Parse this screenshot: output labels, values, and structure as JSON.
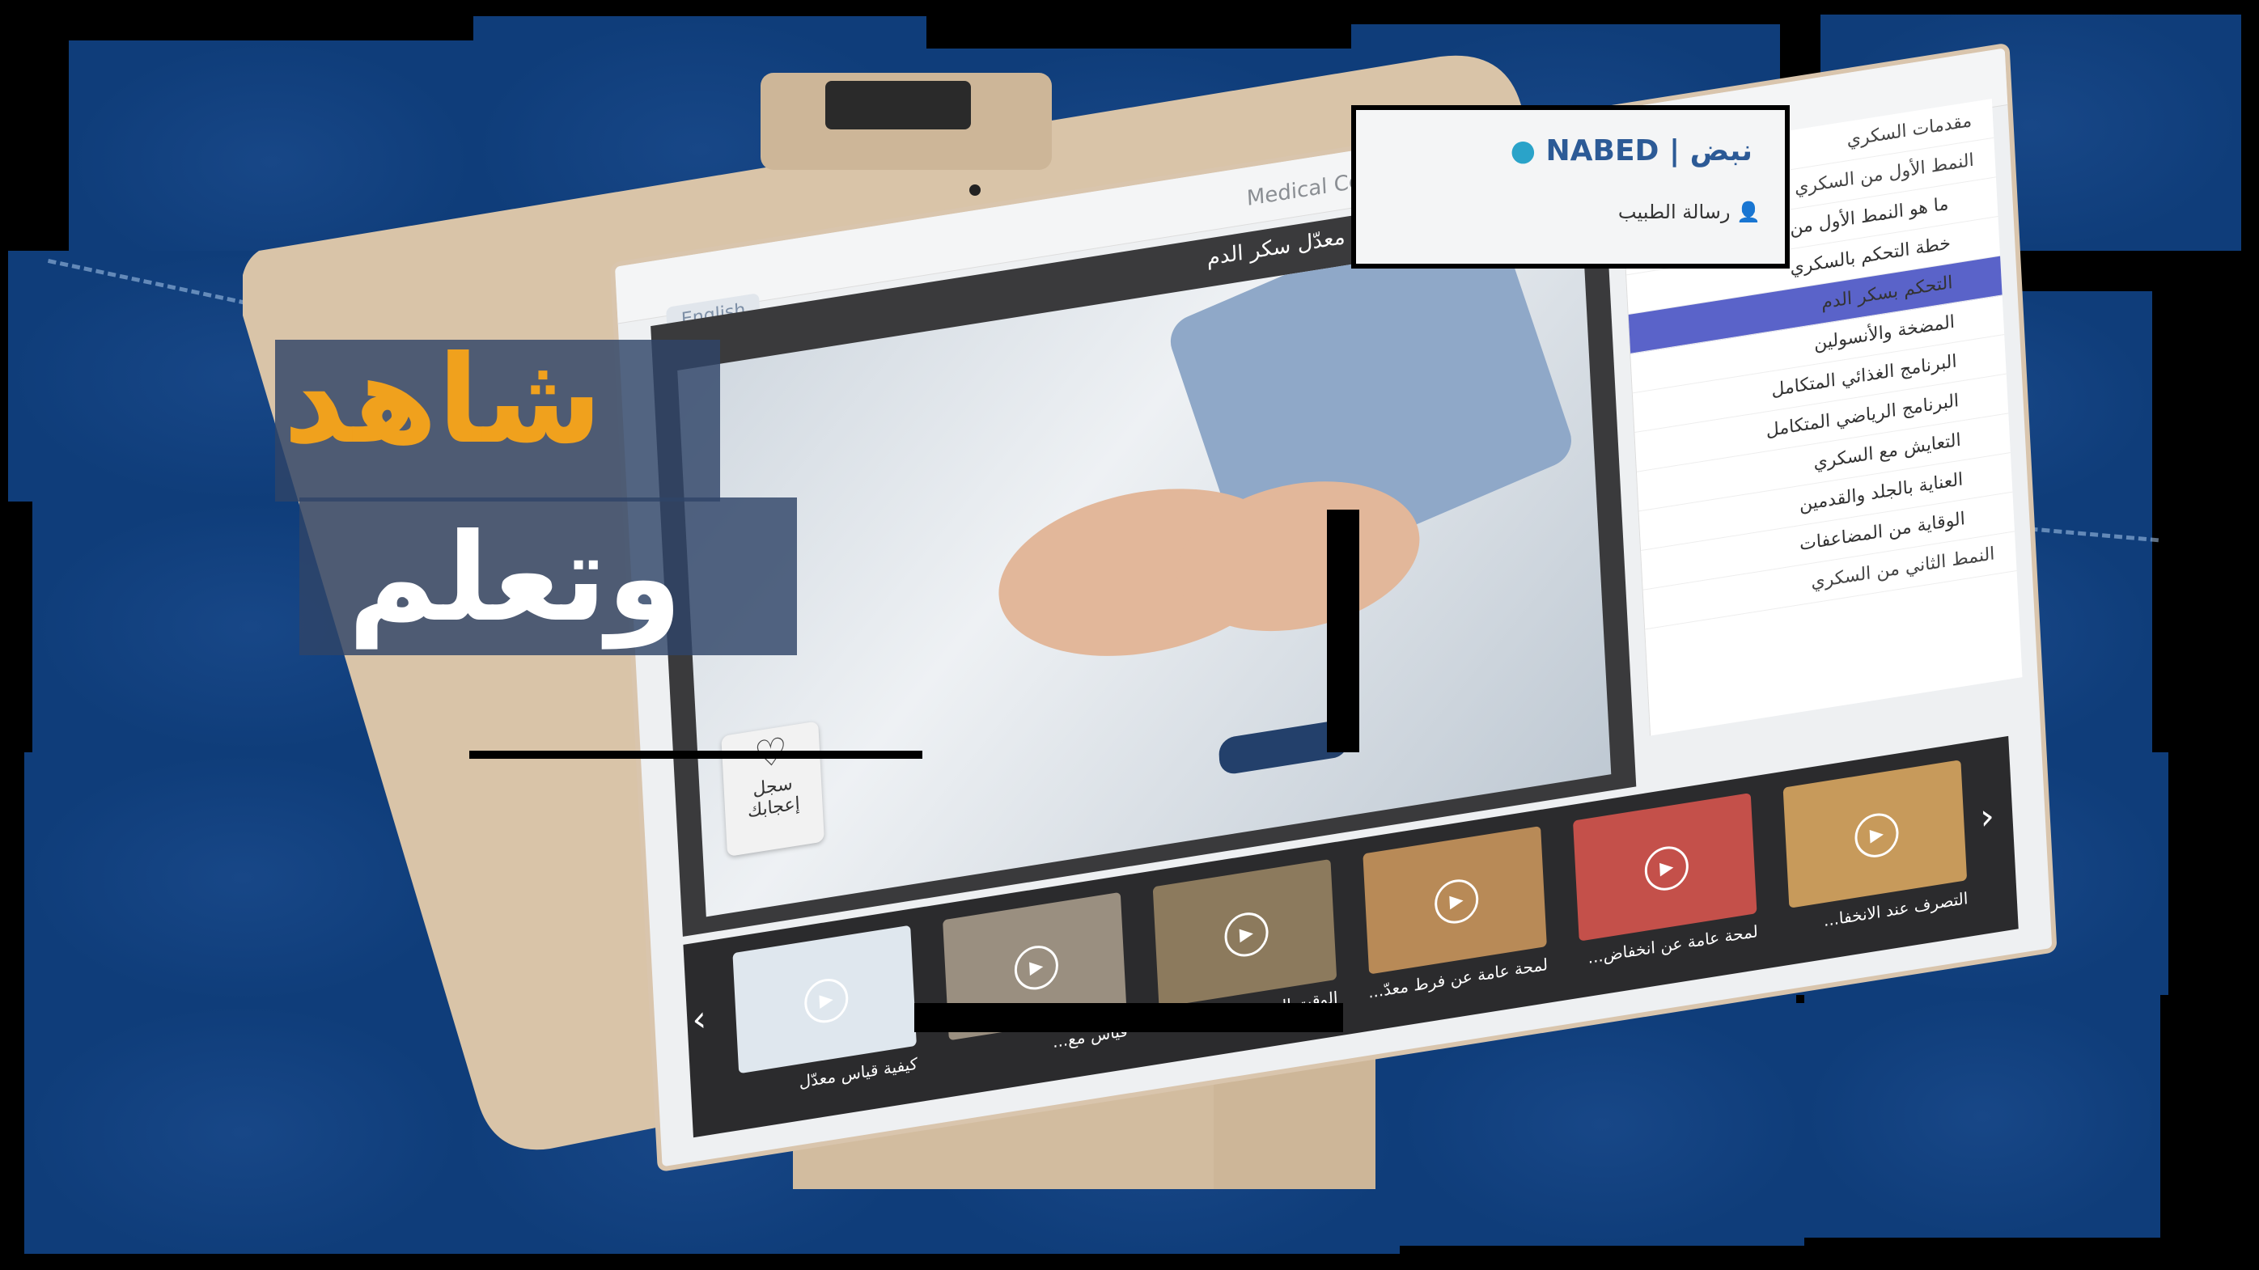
{
  "headline": {
    "line1": "شاهد",
    "line2": "وتعلم",
    "line1_color": "#f0a11d",
    "line2_color": "#ffffff"
  },
  "app": {
    "logo_en": "NABED",
    "logo_ar": "نبض",
    "doctor_message": "رسالة الطبيب",
    "window_title": "Medical Center",
    "language_button": "English",
    "accent_color": "#5a63c9",
    "background_color": "#0f3d7a"
  },
  "video": {
    "title": "كيفية التصرف عند انخفاض معدّل سكر الدم",
    "like_label_line1": "سجل",
    "like_label_line2": "إعجابك"
  },
  "menu": {
    "items": [
      {
        "label": "مقدمات السكري",
        "state": "normal"
      },
      {
        "label": "النمط الأول من السكري",
        "state": "expanded"
      },
      {
        "label": "ما هو النمط الأول من السكري؟",
        "state": "sub"
      },
      {
        "label": "خطة التحكم بالسكري",
        "state": "sub"
      },
      {
        "label": "التحكم بسكر الدم",
        "state": "active"
      },
      {
        "label": "المضخة والأنسولين",
        "state": "sub"
      },
      {
        "label": "البرنامج الغذائي المتكامل",
        "state": "sub"
      },
      {
        "label": "البرنامج الرياضي المتكامل",
        "state": "sub"
      },
      {
        "label": "التعايش مع السكري",
        "state": "sub"
      },
      {
        "label": "العناية بالجلد والقدمين",
        "state": "sub"
      },
      {
        "label": "الوقاية من المضاعفات",
        "state": "sub"
      },
      {
        "label": "النمط الثاني من السكري",
        "state": "normal"
      }
    ]
  },
  "thumbnails": [
    {
      "caption": "كيفية قياس معدّل",
      "icon": "play-icon"
    },
    {
      "caption": "قياس مع...",
      "icon": "play-icon"
    },
    {
      "caption": "الوقت ال...",
      "icon": "play-icon"
    },
    {
      "caption": "لمحة عامة عن فرط معدّ...",
      "icon": "play-icon"
    },
    {
      "caption": "لمحة عامة عن انخفاض...",
      "icon": "play-icon"
    },
    {
      "caption": "التصرف عند الانخفا...",
      "icon": "play-icon"
    }
  ],
  "icons": {
    "prev": "chevron-left-icon",
    "next": "chevron-right-icon",
    "like": "heart-icon",
    "doctor": "doctor-icon"
  }
}
